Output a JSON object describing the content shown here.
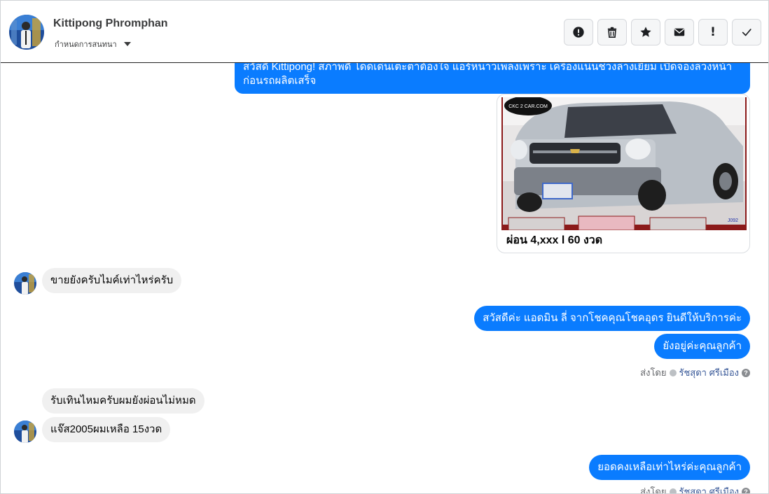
{
  "header": {
    "contact_name": "Kittipong Phromphan",
    "subtitle": "กำหนดการสนทนา"
  },
  "toolbar": {
    "buttons": [
      {
        "icon": "alert-circle-icon"
      },
      {
        "icon": "trash-icon"
      },
      {
        "icon": "star-icon"
      },
      {
        "icon": "mail-icon"
      },
      {
        "icon": "exclamation-icon",
        "glyph": "!"
      },
      {
        "icon": "check-icon"
      }
    ]
  },
  "messages": {
    "greeting_line1": "สวัสดี Kittipong! สภาพดี โดดเด่นเตะตาต้องใจ แอร์หนาวเพลงเพราะ เครื่องแน่นช่วงล่างเยี่ยม เปิดจองล่วงหน้า",
    "greeting_line2": "ก่อนรถผลิตเสร็จ",
    "card_caption": "ผ่อน 4,xxx l 60 งวด",
    "card_logo": "CKC 2 CAR.COM",
    "card_code": "J092",
    "in_1": "ขายยังครับไมค์เท่าไหร่ครับ",
    "out_1": "สวัสดีค่ะ แอดมิน ลี่ จากโชคคุณโชคอุดร ยินดีให้บริการค่ะ",
    "out_2": "ยังอยู่ค่ะคุณลูกค้า",
    "sent_by_label": "ส่งโดย",
    "sent_by_name": "รัชสุดา ศรีเมือง",
    "in_2": "รับเทินไหมครับผมยังผ่อนไม่หมด",
    "in_3": "แจ๊ส2005ผมเหลือ 15งวด",
    "out_3": "ยอดคงเหลือเท่าไหร่ค่ะคุณลูกค้า"
  },
  "colors": {
    "outgoing_bubble": "#0a7cff",
    "incoming_bubble": "#f0f0f0"
  }
}
